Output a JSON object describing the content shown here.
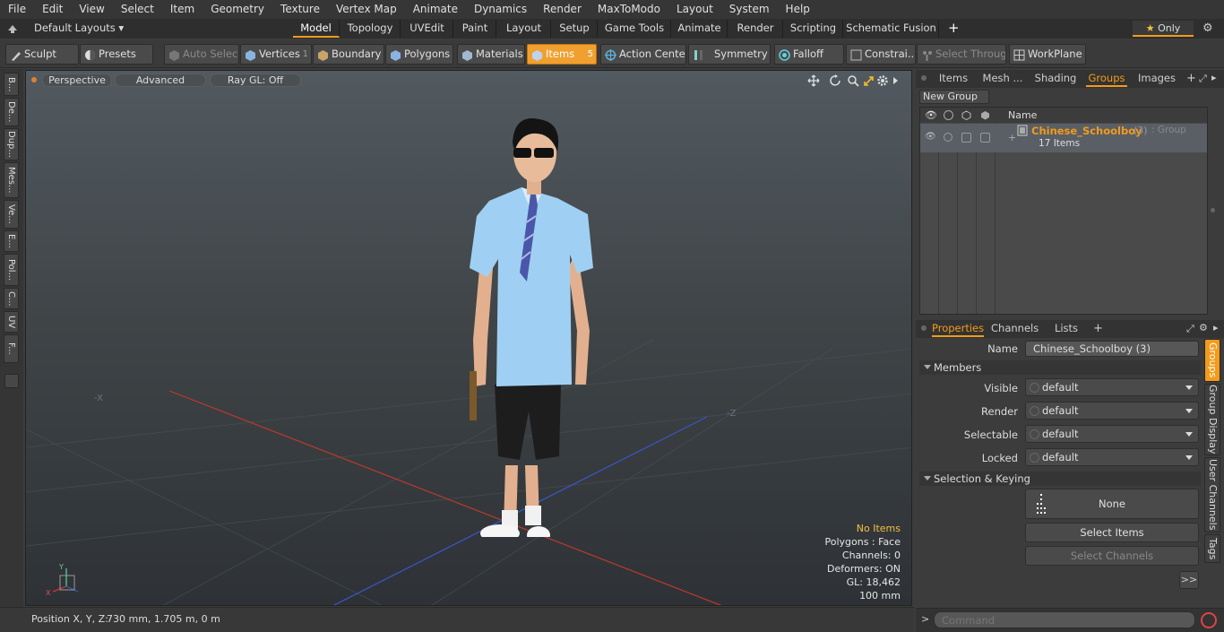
{
  "menu": [
    "File",
    "Edit",
    "View",
    "Select",
    "Item",
    "Geometry",
    "Texture",
    "Vertex Map",
    "Animate",
    "Dynamics",
    "Render",
    "MaxToModo",
    "Layout",
    "System",
    "Help"
  ],
  "layouts_label": "Default Layouts",
  "mode_tabs": [
    "Model",
    "Topology",
    "UVEdit",
    "Paint",
    "Layout",
    "Setup",
    "Game Tools",
    "Animate",
    "Render",
    "Scripting",
    "Schematic Fusion"
  ],
  "only_label": "Only",
  "toolbar": {
    "sculpt": "Sculpt",
    "presets": "Presets",
    "auto_select": "Auto Select",
    "vertices": "Vertices",
    "vertices_count": "1",
    "boundary": "Boundary",
    "polygons": "Polygons",
    "materials": "Materials",
    "items": "Items",
    "items_count": "5",
    "action_center": "Action Center",
    "symmetry": "Symmetry",
    "falloff": "Falloff",
    "constraints": "Constrai...",
    "select_through": "Select Through",
    "workplane": "WorkPlane"
  },
  "left_tabs": [
    "B...",
    "De...",
    "Dup...",
    "Mes...",
    "Ve...",
    "E...",
    "Pol...",
    "C...",
    "UV",
    "F..."
  ],
  "viewport": {
    "perspective": "Perspective",
    "advanced": "Advanced",
    "raygl": "Ray GL: Off",
    "stats": {
      "no_items": "No Items",
      "polygons": "Polygons : Face",
      "channels": "Channels: 0",
      "deformers": "Deformers: ON",
      "gl": "GL: 18,462",
      "scale": "100 mm"
    },
    "colors": {
      "no_items": "#f5c040",
      "x_axis": "#c0392b",
      "z_axis": "#3a56c8"
    }
  },
  "status": {
    "label": "Position X, Y, Z:",
    "value": "730 mm, 1.705 m, 0 m"
  },
  "scene_panel": {
    "tabs": [
      "Items",
      "Mesh ...",
      "Shading",
      "Groups",
      "Images"
    ],
    "active_tab": "Groups",
    "new_group": "New Group",
    "col_name": "Name",
    "group_name": "Chinese_Schoolboy",
    "group_count": "(3)",
    "group_type": ": Group",
    "group_items": "17 Items"
  },
  "props_panel": {
    "tabs": [
      "Properties",
      "Channels",
      "Lists"
    ],
    "name_label": "Name",
    "name_value": "Chinese_Schoolboy (3)",
    "members_header": "Members",
    "visible_label": "Visible",
    "visible_value": "default",
    "render_label": "Render",
    "render_value": "default",
    "selectable_label": "Selectable",
    "selectable_value": "default",
    "locked_label": "Locked",
    "locked_value": "default",
    "selkey_header": "Selection & Keying",
    "none_label": "None",
    "select_items": "Select Items",
    "select_channels": "Select Channels",
    "more": ">>",
    "side_tabs": [
      "Groups",
      "Group Display",
      "User Channels",
      "Tags"
    ]
  },
  "command_placeholder": "Command",
  "accent": "#f29b1c"
}
